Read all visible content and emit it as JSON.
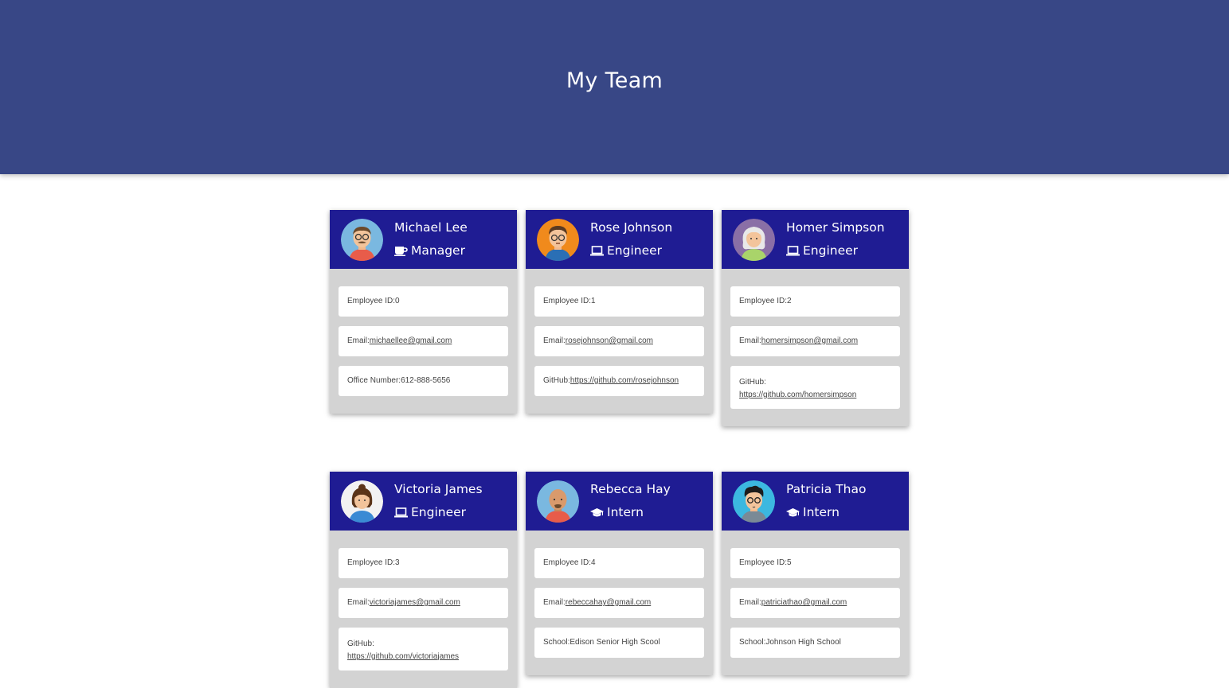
{
  "header": {
    "title": "My Team"
  },
  "labels": {
    "id": "Employee ID: ",
    "email": "Email: ",
    "office": "Office Number: ",
    "github": "GitHub: ",
    "school": "School: "
  },
  "team": [
    {
      "name": "Michael Lee",
      "role": "Manager",
      "role_icon": "mug-icon",
      "avatar_color": "#7ab8e0",
      "id": "0",
      "email": "michaellee@gmail.com",
      "office": "612-888-5656"
    },
    {
      "name": "Rose Johnson",
      "role": "Engineer",
      "role_icon": "laptop-icon",
      "avatar_color": "#f08a1c",
      "id": "1",
      "email": "rosejohnson@gmail.com",
      "github": "https://github.com/rosejohnson"
    },
    {
      "name": "Homer Simpson",
      "role": "Engineer",
      "role_icon": "laptop-icon",
      "avatar_color": "#8a6fa6",
      "id": "2",
      "email": "homersimpson@gmail.com",
      "github": "https://github.com/homersimpson"
    },
    {
      "name": "Victoria James",
      "role": "Engineer",
      "role_icon": "laptop-icon",
      "avatar_color": "#f2f2f2",
      "id": "3",
      "email": "victoriajames@gmail.com",
      "github": "https://github.com/victoriajames"
    },
    {
      "name": "Rebecca Hay",
      "role": "Intern",
      "role_icon": "graduation-cap-icon",
      "avatar_color": "#7ab8e0",
      "id": "4",
      "email": "rebeccahay@gmail.com",
      "school": "Edison Senior High Scool"
    },
    {
      "name": "Patricia Thao",
      "role": "Intern",
      "role_icon": "graduation-cap-icon",
      "avatar_color": "#3cb8e0",
      "id": "5",
      "email": "patriciathao@gmail.com",
      "school": "Johnson High School"
    }
  ],
  "colors": {
    "header_bg": "#384786",
    "card_head_bg": "#1f1c93",
    "card_body_bg": "#d3d3d3"
  }
}
